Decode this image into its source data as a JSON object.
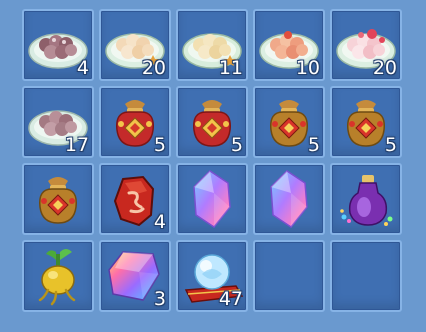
{
  "inventory": {
    "slots": [
      {
        "icon": "white-dumpling-plate-icon",
        "count": "4"
      },
      {
        "icon": "peach-dumpling-plate-icon",
        "count": "20"
      },
      {
        "icon": "peach-dumpling-plate-icon",
        "count": "11"
      },
      {
        "icon": "orange-dumpling-plate-icon",
        "count": "10"
      },
      {
        "icon": "pink-dumpling-plate-icon",
        "count": "20"
      },
      {
        "icon": "dumpling-plate-icon",
        "count": "17"
      },
      {
        "icon": "red-lucky-bag-icon",
        "count": "5"
      },
      {
        "icon": "red-lucky-bag-icon",
        "count": "5"
      },
      {
        "icon": "golden-lucky-bag-icon",
        "count": "5"
      },
      {
        "icon": "golden-lucky-bag-icon",
        "count": "5"
      },
      {
        "icon": "golden-lucky-bag-icon",
        "count": ""
      },
      {
        "icon": "red-rune-stone-icon",
        "count": "4"
      },
      {
        "icon": "rainbow-crystal-icon",
        "count": ""
      },
      {
        "icon": "rainbow-crystal-icon",
        "count": ""
      },
      {
        "icon": "purple-potion-vase-icon",
        "count": ""
      },
      {
        "icon": "golden-root-sprout-icon",
        "count": ""
      },
      {
        "icon": "rainbow-gem-icon",
        "count": "3"
      },
      {
        "icon": "crystal-orb-on-cushion-icon",
        "count": "47"
      },
      {
        "icon": "",
        "count": ""
      },
      {
        "icon": "",
        "count": ""
      }
    ]
  }
}
